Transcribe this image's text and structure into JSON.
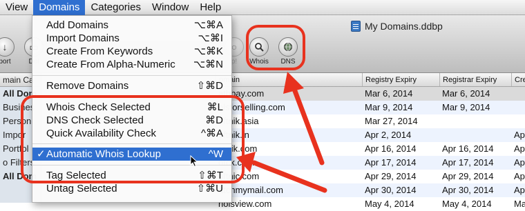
{
  "menubar": {
    "items": [
      "View",
      "Domains",
      "Categories",
      "Window",
      "Help"
    ]
  },
  "window": {
    "title": "My Domains.ddbp"
  },
  "toolbar": {
    "left_buttons": [
      "port",
      "Del"
    ],
    "faded_button": "p!",
    "whois_label": "Whois",
    "dns_label": "DNS"
  },
  "sidebar": {
    "header": "main Ca",
    "items": [
      "All Dom",
      "Busines",
      "Person",
      "Impor",
      "Portfol",
      "o Filters",
      "All Dom"
    ]
  },
  "table": {
    "headers": [
      "omain",
      "Registry Expiry",
      "Registrar Expiry",
      "Creat"
    ],
    "rows": [
      [
        "athbay.com",
        "Mar 6, 2014",
        "Mar 6, 2014",
        ""
      ],
      [
        "olsforselling.com",
        "Mar 9, 2014",
        "Mar 9, 2014",
        ""
      ],
      [
        "oftnik.asia",
        "Mar 27, 2014",
        "",
        ""
      ],
      [
        "oftnik.in",
        "Apr 2, 2014",
        "",
        "Apr"
      ],
      [
        "ranik.com",
        "Apr 16, 2014",
        "Apr 16, 2014",
        "Apr"
      ],
      [
        "ofck.com",
        "Apr 17, 2014",
        "Apr 17, 2014",
        "Apr"
      ],
      [
        "oftnic.com",
        "Apr 29, 2014",
        "Apr 29, 2014",
        "Apr"
      ],
      [
        "atchmymail.com",
        "Apr 30, 2014",
        "Apr 30, 2014",
        "Apr"
      ],
      [
        "hoisview.com",
        "May 4, 2014",
        "May 4, 2014",
        "May"
      ]
    ]
  },
  "domains_menu": {
    "add_domains": {
      "label": "Add Domains",
      "shortcut": "⌥⌘A"
    },
    "import_domains": {
      "label": "Import Domains",
      "shortcut": "⌥⌘I"
    },
    "create_keywords": {
      "label": "Create From Keywords",
      "shortcut": "⌥⌘K"
    },
    "create_alpha": {
      "label": "Create From Alpha-Numeric",
      "shortcut": "⌥⌘N"
    },
    "remove_domains": {
      "label": "Remove Domains",
      "shortcut": "⇧⌘D"
    },
    "whois_check": {
      "label": "Whois Check Selected",
      "shortcut": "⌘L"
    },
    "dns_check": {
      "label": "DNS Check Selected",
      "shortcut": "⌘D"
    },
    "quick_check": {
      "label": "Quick Availability Check",
      "shortcut": "^⌘A"
    },
    "auto_whois": {
      "label": "Automatic Whois Lookup",
      "shortcut": "^W",
      "checked": true,
      "check": "✓"
    },
    "tag_selected": {
      "label": "Tag Selected",
      "shortcut": "⇧⌘T"
    },
    "untag_selected": {
      "label": "Untag Selected",
      "shortcut": "⇧⌘U"
    }
  },
  "colors": {
    "highlight": "#2f6fd0",
    "annotation": "#e8321e"
  }
}
